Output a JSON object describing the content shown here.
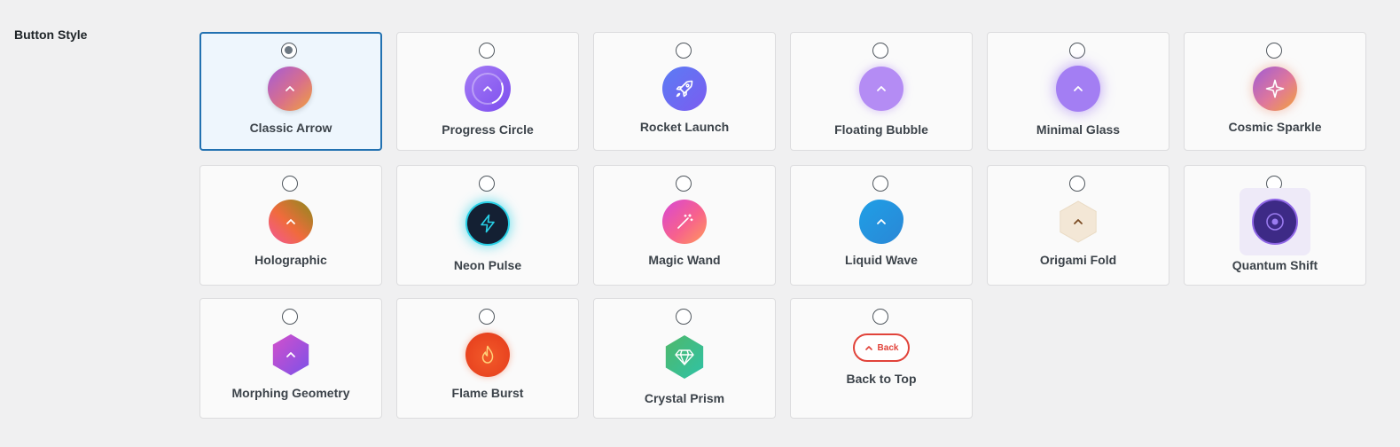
{
  "field": {
    "label": "Button Style"
  },
  "options": [
    {
      "id": "classic-arrow",
      "label": "Classic Arrow",
      "selected": true
    },
    {
      "id": "progress-circle",
      "label": "Progress Circle",
      "selected": false
    },
    {
      "id": "rocket-launch",
      "label": "Rocket Launch",
      "selected": false
    },
    {
      "id": "floating-bubble",
      "label": "Floating Bubble",
      "selected": false
    },
    {
      "id": "minimal-glass",
      "label": "Minimal Glass",
      "selected": false
    },
    {
      "id": "cosmic-sparkle",
      "label": "Cosmic Sparkle",
      "selected": false
    },
    {
      "id": "holographic",
      "label": "Holographic",
      "selected": false
    },
    {
      "id": "neon-pulse",
      "label": "Neon Pulse",
      "selected": false
    },
    {
      "id": "magic-wand",
      "label": "Magic Wand",
      "selected": false
    },
    {
      "id": "liquid-wave",
      "label": "Liquid Wave",
      "selected": false
    },
    {
      "id": "origami-fold",
      "label": "Origami Fold",
      "selected": false
    },
    {
      "id": "quantum-shift",
      "label": "Quantum Shift",
      "selected": false
    },
    {
      "id": "morphing-geometry",
      "label": "Morphing Geometry",
      "selected": false
    },
    {
      "id": "flame-burst",
      "label": "Flame Burst",
      "selected": false
    },
    {
      "id": "crystal-prism",
      "label": "Crystal Prism",
      "selected": false
    },
    {
      "id": "back-to-top",
      "label": "Back to Top",
      "selected": false,
      "pill_text": "Back"
    }
  ],
  "icons": [
    "chevron-up-icon",
    "progress-ring-icon",
    "rocket-icon",
    "sparkle-icon",
    "lightning-icon",
    "magic-wand-icon",
    "target-icon",
    "flame-icon",
    "diamond-icon"
  ],
  "colors": {
    "selected_border": "#2271b1",
    "selected_bg": "#eef6fd",
    "back_pill": "#e1433a"
  }
}
